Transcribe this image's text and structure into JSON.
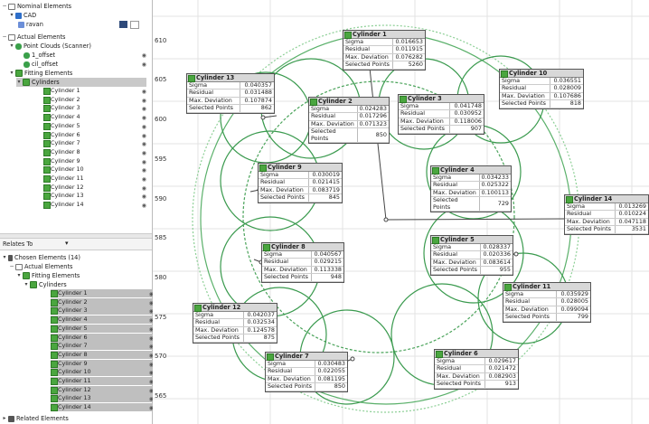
{
  "tree_top": {
    "nominal": "Nominal Elements",
    "cad": "CAD",
    "ravan": "ravan",
    "actual": "Actual Elements",
    "pointclouds": "Point Clouds (Scanner)",
    "offset1": "1_offset",
    "offset2": "cil_offset",
    "fitting": "Fitting Elements",
    "cylinders": "Cylinders"
  },
  "cylinders_list": [
    "Cylinder 1",
    "Cylinder 2",
    "Cylinder 3",
    "Cylinder 4",
    "Cylinder 5",
    "Cylinder 6",
    "Cylinder 7",
    "Cylinder 8",
    "Cylinder 9",
    "Cylinder 10",
    "Cylinder 11",
    "Cylinder 12",
    "Cylinder 13",
    "Cylinder 14"
  ],
  "relates": {
    "title": "Relates To",
    "chosen": "Chosen Elements (14)",
    "actual": "Actual Elements",
    "fitting": "Fitting Elements",
    "cylinders": "Cylinders",
    "related": "Related Elements"
  },
  "yticks": [
    "610",
    "605",
    "600",
    "595",
    "590",
    "585",
    "580",
    "575",
    "570",
    "565"
  ],
  "labels": {
    "sigma": "Sigma",
    "residual": "Residual",
    "maxdev": "Max. Deviation",
    "selpts": "Selected Points"
  },
  "boxes": [
    {
      "name": "Cylinder 1",
      "sigma": "0.016653",
      "residual": "0.011915",
      "maxdev": "0.076282",
      "selpts": "5260"
    },
    {
      "name": "Cylinder 2",
      "sigma": "0.024283",
      "residual": "0.017296",
      "maxdev": "0.071323",
      "selpts": "850"
    },
    {
      "name": "Cylinder 3",
      "sigma": "0.041748",
      "residual": "0.030952",
      "maxdev": "0.118006",
      "selpts": "907"
    },
    {
      "name": "Cylinder 4",
      "sigma": "0.034233",
      "residual": "0.025322",
      "maxdev": "0.100113",
      "selpts": "729"
    },
    {
      "name": "Cylinder 5",
      "sigma": "0.028337",
      "residual": "0.020336",
      "maxdev": "0.083614",
      "selpts": "955"
    },
    {
      "name": "Cylinder 6",
      "sigma": "0.029617",
      "residual": "0.021472",
      "maxdev": "0.082903",
      "selpts": "913"
    },
    {
      "name": "Cylinder 7",
      "sigma": "0.030483",
      "residual": "0.022055",
      "maxdev": "0.081195",
      "selpts": "850"
    },
    {
      "name": "Cylinder 8",
      "sigma": "0.040567",
      "residual": "0.029215",
      "maxdev": "0.113338",
      "selpts": "948"
    },
    {
      "name": "Cylinder 9",
      "sigma": "0.030019",
      "residual": "0.021415",
      "maxdev": "0.083719",
      "selpts": "845"
    },
    {
      "name": "Cylinder 10",
      "sigma": "0.036551",
      "residual": "0.028009",
      "maxdev": "0.107686",
      "selpts": "818"
    },
    {
      "name": "Cylinder 11",
      "sigma": "0.035929",
      "residual": "0.028005",
      "maxdev": "0.099094",
      "selpts": "799"
    },
    {
      "name": "Cylinder 12",
      "sigma": "0.042037",
      "residual": "0.032534",
      "maxdev": "0.124578",
      "selpts": "875"
    },
    {
      "name": "Cylinder 13",
      "sigma": "0.040357",
      "residual": "0.031488",
      "maxdev": "0.107874",
      "selpts": "862"
    },
    {
      "name": "Cylinder 14",
      "sigma": "0.013269",
      "residual": "0.010224",
      "maxdev": "0.047118",
      "selpts": "3531"
    }
  ]
}
